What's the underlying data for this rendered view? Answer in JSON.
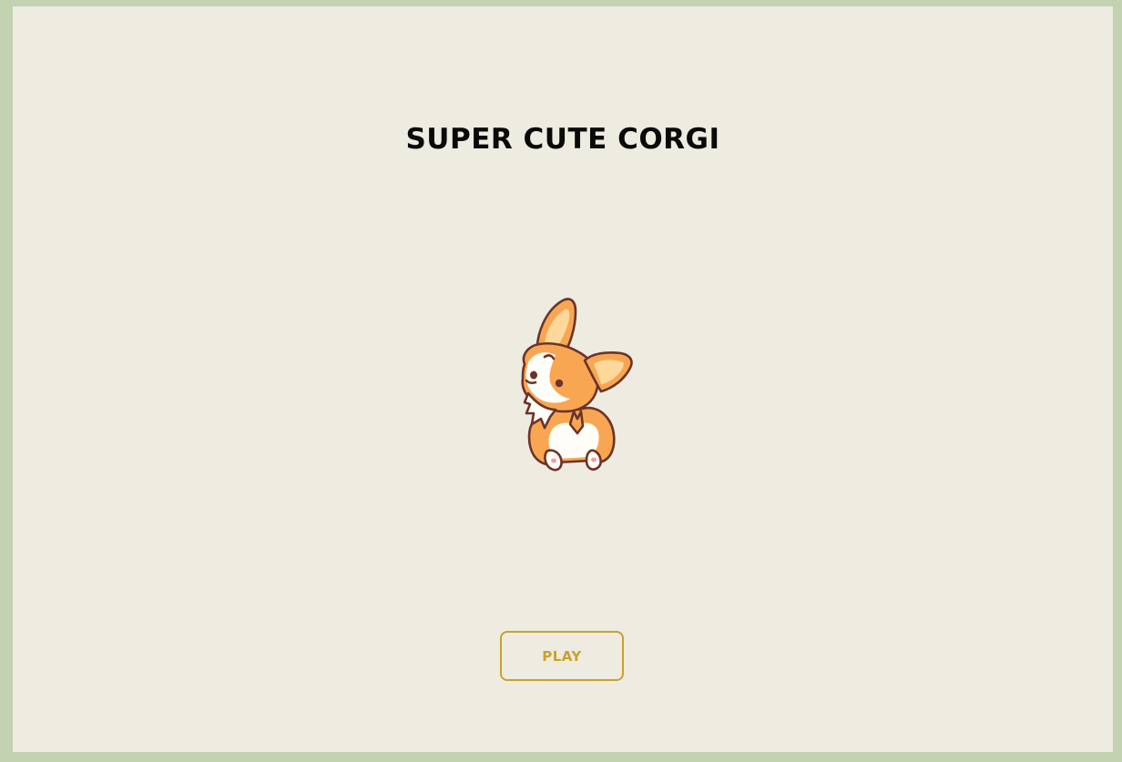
{
  "game": {
    "title": "SUPER CUTE CORGI",
    "play_label": "PLAY"
  },
  "character": {
    "name": "corgi-icon"
  },
  "colors": {
    "outer_border": "#c3d3b2",
    "background": "#eeebe1",
    "title": "#0a0a0a",
    "button_accent": "#c9a22c",
    "corgi_orange": "#f9a653",
    "corgi_outline": "#6b3428",
    "corgi_white": "#fffdf8",
    "corgi_inner_ear": "#fcd99a"
  }
}
